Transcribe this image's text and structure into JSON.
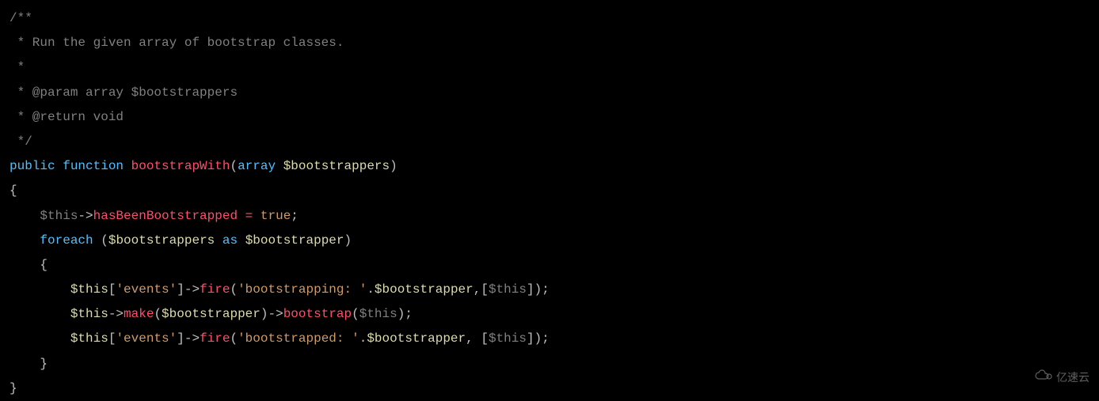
{
  "code": {
    "c1": "/**",
    "c2": " * Run the given array of bootstrap classes.",
    "c3": " *",
    "c4": " * @param array $bootstrappers",
    "c5": " * @return void",
    "c6": " */",
    "kw_public": "public",
    "kw_function": "function",
    "fn_name": "bootstrapWith",
    "type_array": "array",
    "param_bootstrappers": "$bootstrappers",
    "var_this1": "$this",
    "prop_hasBeenBootstrapped": "hasBeenBootstrapped",
    "val_true": "true",
    "kw_foreach": "foreach",
    "var_bootstrappers": "$bootstrappers",
    "kw_as": "as",
    "var_bootstrapper": "$bootstrapper",
    "var_this2": "$this",
    "str_events1": "'events'",
    "method_fire1": "fire",
    "str_bootstrapping": "'bootstrapping: '",
    "var_bootstrapper2": "$bootstrapper",
    "var_this3": "$this",
    "var_this4": "$this",
    "method_make": "make",
    "var_bootstrapper3": "$bootstrapper",
    "method_bootstrap": "bootstrap",
    "var_this5": "$this",
    "var_this6": "$this",
    "str_events2": "'events'",
    "method_fire2": "fire",
    "str_bootstrapped": "'bootstrapped: '",
    "var_bootstrapper4": "$bootstrapper",
    "var_this7": "$this"
  },
  "watermark": {
    "text": "亿速云"
  }
}
